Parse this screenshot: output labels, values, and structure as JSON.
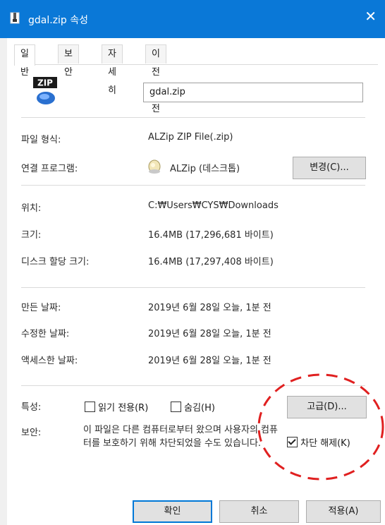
{
  "window": {
    "title": "gdal.zip 속성",
    "close_glyph": "✕"
  },
  "tabs": [
    {
      "label": "일반",
      "active": true
    },
    {
      "label": "보안",
      "active": false
    },
    {
      "label": "자세히",
      "active": false
    },
    {
      "label": "이전 버전",
      "active": false
    }
  ],
  "file": {
    "icon": "zip-archive-icon",
    "icon_text": "ZIP",
    "name": "gdal.zip"
  },
  "type": {
    "label": "파일 형식:",
    "value": "ALZip ZIP File(.zip)"
  },
  "opens_with": {
    "label": "연결 프로그램:",
    "value": "ALZip (데스크톱)",
    "icon": "alzip-app-icon",
    "change_button": "변경(C)..."
  },
  "location": {
    "label": "위치:",
    "value": "C:₩Users₩CYS₩Downloads"
  },
  "size": {
    "label": "크기:",
    "value": "16.4MB (17,296,681 바이트)"
  },
  "size_on_disk": {
    "label": "디스크 할당 크기:",
    "value": "16.4MB (17,297,408 바이트)"
  },
  "created": {
    "label": "만든 날짜:",
    "value": "2019년 6월 28일 오늘, 1분 전"
  },
  "modified": {
    "label": "수정한 날짜:",
    "value": "2019년 6월 28일 오늘, 1분 전"
  },
  "accessed": {
    "label": "액세스한 날짜:",
    "value": "2019년 6월 28일 오늘, 1분 전"
  },
  "attributes": {
    "label": "특성:",
    "readonly": {
      "label": "읽기 전용(R)",
      "checked": false
    },
    "hidden": {
      "label": "숨김(H)",
      "checked": false
    },
    "advanced_button": "고급(D)..."
  },
  "security": {
    "label": "보안:",
    "text": "이 파일은 다른 컴퓨터로부터 왔으며 사용자의 컴퓨터를 보호하기 위해 차단되었을 수도 있습니다.",
    "unblock": {
      "label": "차단 해제(K)",
      "checked": true
    }
  },
  "buttons": {
    "ok": "확인",
    "cancel": "취소",
    "apply": "적용(A)"
  },
  "annotation_color": "#e02020"
}
